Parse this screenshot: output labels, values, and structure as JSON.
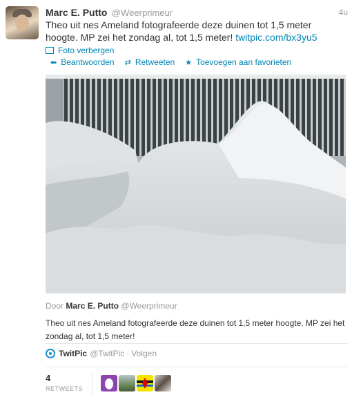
{
  "tweet": {
    "fullname": "Marc E. Putto",
    "username": "@Weerprimeur",
    "time": "4u",
    "text": "Theo uit nes Ameland fotografeerde deze duinen tot 1,5 meter hoogte. MP zei het zondag al, tot 1,5 meter!",
    "link": "twitpic.com/bx3yu5"
  },
  "media_toggle": "Foto verbergen",
  "actions": {
    "reply": "Beantwoorden",
    "retweet": "Retweeten",
    "favorite": "Toevoegen aan favorieten"
  },
  "card": {
    "by_prefix": "Door",
    "by_name": "Marc E. Putto",
    "by_handle": "@Weerprimeur",
    "caption": "Theo uit nes Ameland fotografeerde deze duinen tot 1,5 meter hoogte. MP zei het zondag al, tot 1,5 meter!",
    "provider_name": "TwitPic",
    "provider_handle": "@TwitPic",
    "separator": "·",
    "follow": "Volgen"
  },
  "stats": {
    "retweets_count": "4",
    "retweets_label": "RETWEETS"
  },
  "icons": {
    "reply": "reply-arrow-icon",
    "retweet": "retweet-icon",
    "favorite": "star-icon",
    "media": "photo-icon",
    "provider": "twitpic-logo"
  },
  "colors": {
    "link": "#0084b4",
    "name": "#333333",
    "meta": "#999999"
  }
}
